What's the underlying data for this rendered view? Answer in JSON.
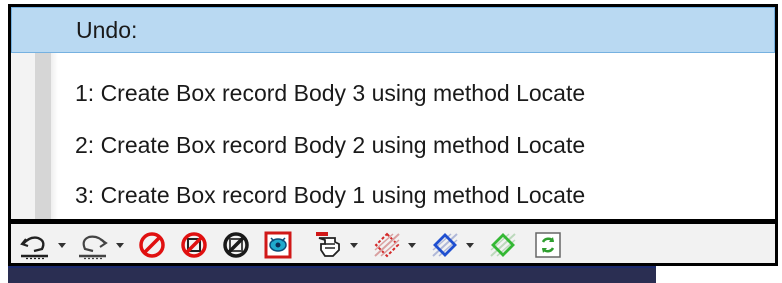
{
  "undo_menu": {
    "header": "Undo:",
    "items": [
      "1: Create Box record Body 3 using method Locate",
      "2: Create Box record Body 2 using method Locate",
      "3: Create Box record Body 1 using method Locate"
    ]
  },
  "toolbar": {
    "icons": [
      "undo-icon",
      "redo-icon",
      "cancel-icon",
      "cancel-icon",
      "cancel-icon",
      "inspect-icon",
      "pointer-hand-icon",
      "select-filter-icon",
      "select-filter-icon",
      "select-filter-icon",
      "refresh-icon"
    ]
  },
  "colors": {
    "highlight": "#b9d9f2",
    "highlight_border": "#76b1e0",
    "cancel_red": "#e01010",
    "refresh_green": "#2e9e2e",
    "select_red": "#d42a2a",
    "select_blue": "#1f4fd0",
    "select_green": "#34b834"
  }
}
